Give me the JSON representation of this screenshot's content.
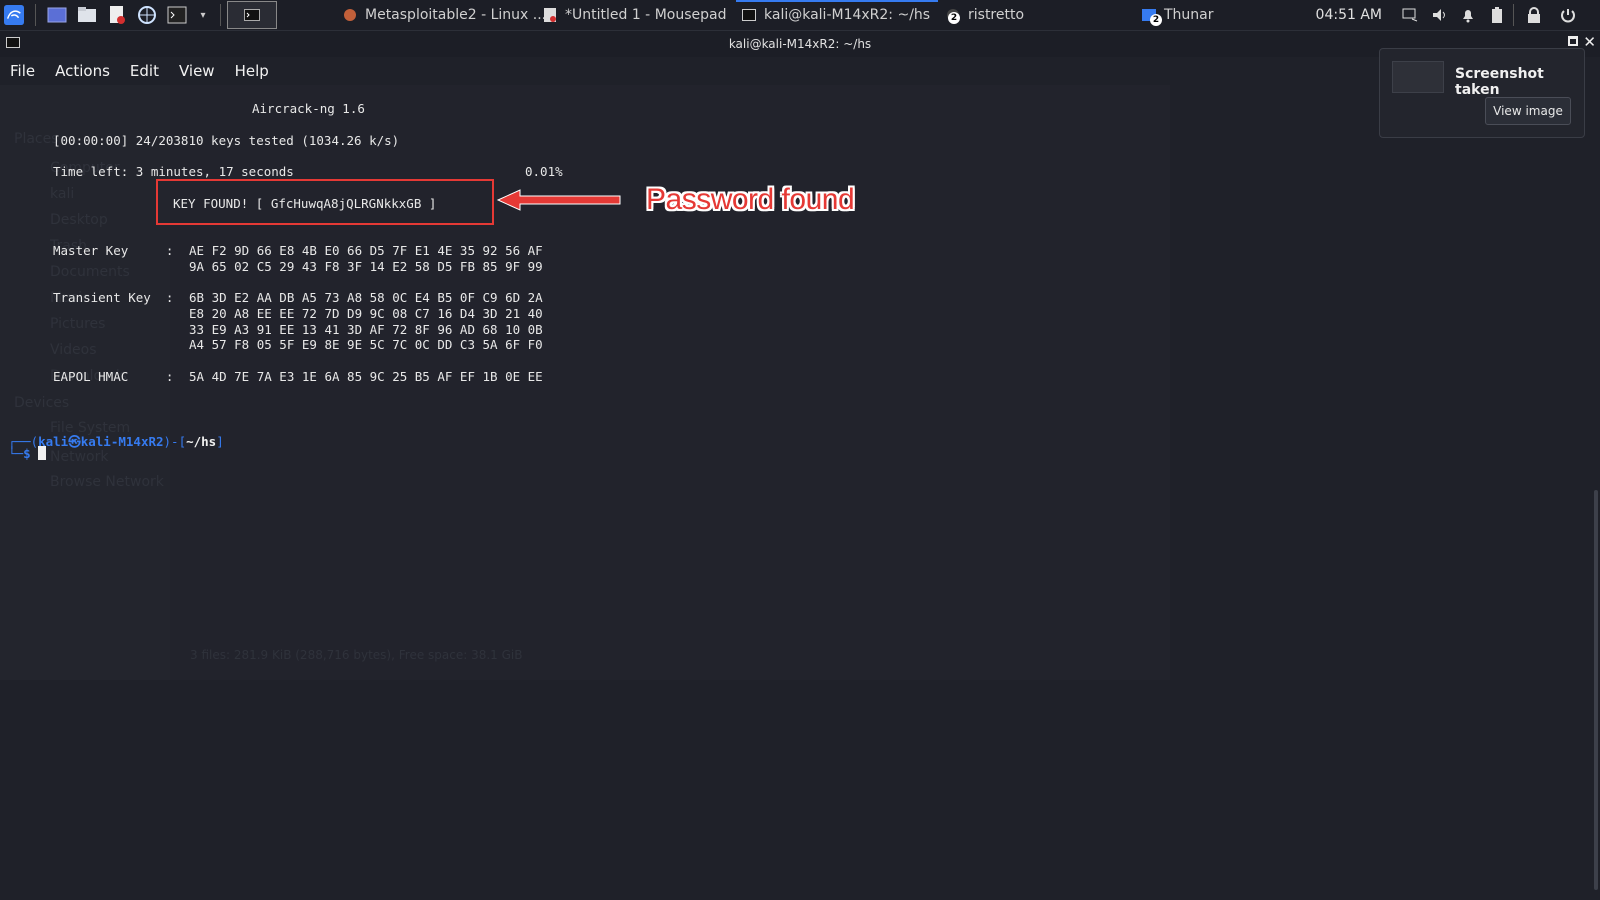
{
  "taskbar": {
    "tasks": [
      {
        "label": "Metasploitable2 - Linux ..."
      },
      {
        "label": "*Untitled 1 - Mousepad"
      },
      {
        "label": "kali@kali-M14xR2: ~/hs"
      },
      {
        "label": "ristretto",
        "badge": "2"
      },
      {
        "label": "Thunar",
        "badge": "2"
      }
    ],
    "clock": "04:51 AM"
  },
  "window": {
    "title": "kali@kali-M14xR2: ~/hs",
    "menu": [
      "File",
      "Actions",
      "Edit",
      "View",
      "Help"
    ]
  },
  "terminal": {
    "header": "Aircrack-ng 1.6",
    "progress": "[00:00:00] 24/203810 keys tested (1034.26 k/s)",
    "time_left": "Time left: 3 minutes, 17 seconds",
    "percent": "0.01%",
    "key_found": "KEY FOUND! [ GfcHuwqA8jQLRGNkkxGB ]",
    "master_key_label": "Master Key     :",
    "master_key": [
      "AE F2 9D 66 E8 4B E0 66 D5 7F E1 4E 35 92 56 AF",
      "9A 65 02 C5 29 43 F8 3F 14 E2 58 D5 FB 85 9F 99"
    ],
    "transient_key_label": "Transient Key  :",
    "transient_key": [
      "6B 3D E2 AA DB A5 73 A8 58 0C E4 B5 0F C9 6D 2A",
      "E8 20 A8 EE EE 72 7D D9 9C 08 C7 16 D4 3D 21 40",
      "33 E9 A3 91 EE 13 41 3D AF 72 8F 96 AD 68 10 0B",
      "A4 57 F8 05 5F E9 8E 9E 5C 7C 0C DD C3 5A 6F F0"
    ],
    "eapol_label": "EAPOL HMAC     :",
    "eapol": "5A 4D 7E 7A E3 1E 6A 85 9C 25 B5 AF EF 1B 0E EE",
    "prompt_user": "kali",
    "prompt_at": "㉿",
    "prompt_host": "kali-M14xR2",
    "prompt_dir": "~/hs",
    "prompt_symbol": "$"
  },
  "annotation": {
    "text": "Password found",
    "color": "#e53935"
  },
  "notification": {
    "title": "Screenshot taken",
    "button": "View image"
  },
  "ghost_window": {
    "items": [
      "Places",
      "Computer",
      "kali",
      "Desktop",
      "Trash",
      "Documents",
      "Music",
      "Pictures",
      "Videos",
      "Downloads",
      "Devices",
      "File System",
      "Network",
      "Browse Network"
    ],
    "status": "3 files: 281.9 KiB (288,716 bytes), Free space: 38.1 GiB"
  },
  "colors": {
    "accent": "#367bf0",
    "prompt_user": "#367bf0",
    "annotation": "#e53935"
  }
}
